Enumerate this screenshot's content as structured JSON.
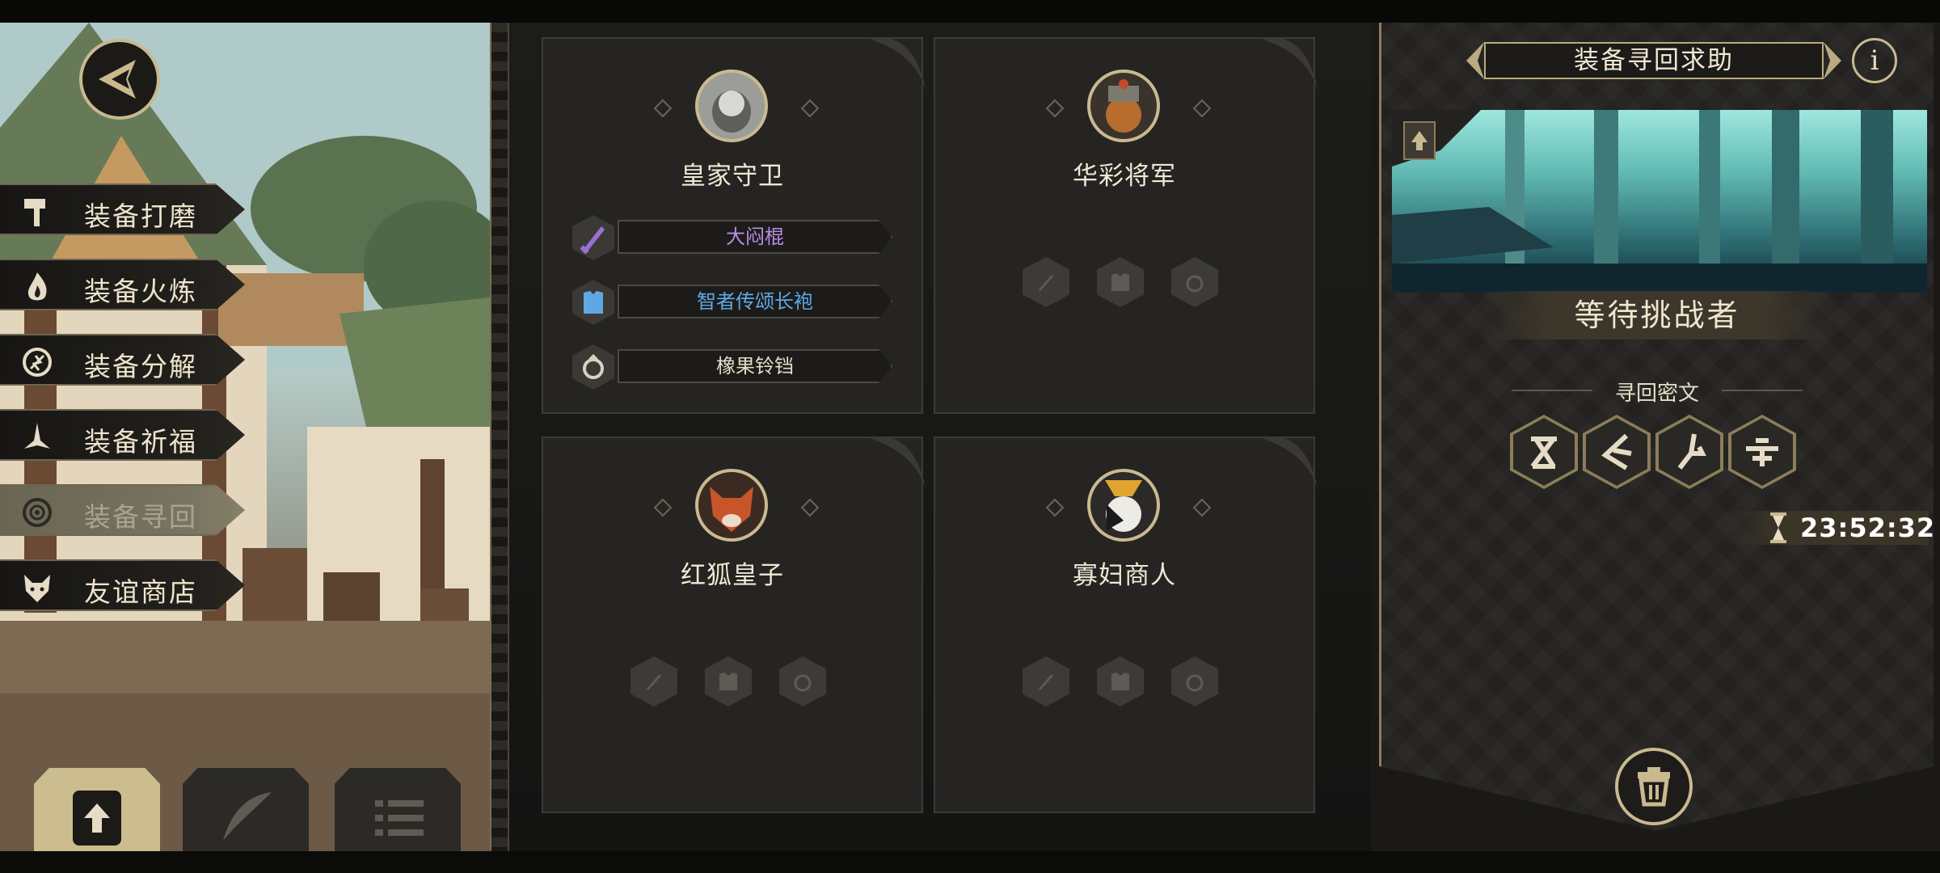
{
  "menu": {
    "items": [
      {
        "label": "装备打磨",
        "icon": "hammer-icon"
      },
      {
        "label": "装备火炼",
        "icon": "flame-icon"
      },
      {
        "label": "装备分解",
        "icon": "disassemble-icon"
      },
      {
        "label": "装备祈福",
        "icon": "pray-icon"
      },
      {
        "label": "装备寻回",
        "icon": "target-icon",
        "active": true
      },
      {
        "label": "友谊商店",
        "icon": "fox-icon"
      }
    ],
    "back_icon": "back-arrow-icon"
  },
  "bottom_tabs": [
    {
      "icon": "upload-icon",
      "active": true
    },
    {
      "icon": "feather-icon"
    },
    {
      "icon": "list-icon"
    }
  ],
  "characters": [
    {
      "name": "皇家守卫",
      "portrait": "wolf-guard-portrait",
      "equipment": [
        {
          "name": "大闷棍",
          "type": "weapon",
          "color": "#b98ee6"
        },
        {
          "name": "智者传颂长袍",
          "type": "armor",
          "color": "#5fa8e6"
        },
        {
          "name": "橡果铃铛",
          "type": "ring",
          "color": "#e6dcc6"
        }
      ]
    },
    {
      "name": "华彩将军",
      "portrait": "general-portrait",
      "equipment": []
    },
    {
      "name": "红狐皇子",
      "portrait": "red-fox-portrait",
      "equipment": []
    },
    {
      "name": "寡妇商人",
      "portrait": "widow-merchant-portrait",
      "equipment": []
    }
  ],
  "panel": {
    "title": "装备寻回求助",
    "info_label": "i",
    "status": "等待挑战者",
    "cipher_label": "寻回密文",
    "cipher_icons": [
      "cipher-rune-1-icon",
      "cipher-rune-2-icon",
      "cipher-rune-3-icon",
      "cipher-rune-4-icon"
    ],
    "timer": "23:52:32"
  },
  "colors": {
    "gold": "#c9b98f",
    "purple_item": "#b98ee6",
    "blue_item": "#5fa8e6"
  }
}
